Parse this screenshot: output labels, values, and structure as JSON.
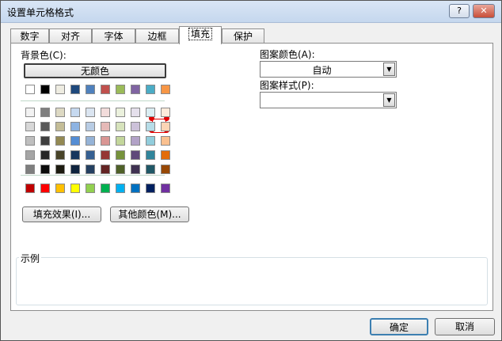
{
  "window": {
    "title": "设置单元格格式",
    "help_label": "?",
    "close_label": "✕"
  },
  "tabs": [
    {
      "label": "数字"
    },
    {
      "label": "对齐"
    },
    {
      "label": "字体"
    },
    {
      "label": "边框"
    },
    {
      "label": "填充",
      "active": true
    },
    {
      "label": "保护"
    }
  ],
  "fill": {
    "background_label": "背景色(C):",
    "no_color_button": "无颜色",
    "palette_top": [
      "#ffffff",
      "#000000",
      "#eeece1",
      "#1f497d",
      "#4f81bd",
      "#c0504d",
      "#9bbb59",
      "#8064a2",
      "#4bacc6",
      "#f79646"
    ],
    "palette_grid": [
      [
        "#f2f2f2",
        "#7f7f7f",
        "#ddd9c3",
        "#c6d9f0",
        "#dbe5f1",
        "#f2dcdb",
        "#ebf1dd",
        "#e5e0ec",
        "#dbeef3",
        "#fdeada"
      ],
      [
        "#d8d8d8",
        "#595959",
        "#c4bd97",
        "#8db3e2",
        "#b8cce4",
        "#e5b9b7",
        "#d7e3bc",
        "#ccc1d9",
        "#b7dde8",
        "#fbd5b5"
      ],
      [
        "#bfbfbf",
        "#3f3f3f",
        "#938953",
        "#548dd4",
        "#95b3d7",
        "#d99694",
        "#c3d69b",
        "#b2a2c7",
        "#92cddc",
        "#fac08f"
      ],
      [
        "#a5a5a5",
        "#262626",
        "#494429",
        "#17365d",
        "#366092",
        "#953734",
        "#76923c",
        "#5f497a",
        "#31859b",
        "#e36c09"
      ],
      [
        "#7f7f7f",
        "#0c0c0c",
        "#1d1b10",
        "#0f243e",
        "#244061",
        "#632423",
        "#4f6128",
        "#3f3151",
        "#205867",
        "#974806"
      ]
    ],
    "palette_standard": [
      "#c00000",
      "#ff0000",
      "#ffc000",
      "#ffff00",
      "#92d050",
      "#00b050",
      "#00b0f0",
      "#0070c0",
      "#002060",
      "#7030a0"
    ],
    "fill_effects_button": "填充效果(I)...",
    "more_colors_button": "其他颜色(M)...",
    "pattern_color_label": "图案颜色(A):",
    "pattern_color_value": "自动",
    "pattern_style_label": "图案样式(P):",
    "pattern_style_value": "",
    "sample_label": "示例"
  },
  "footer": {
    "ok_button": "确定",
    "cancel_button": "取消"
  }
}
